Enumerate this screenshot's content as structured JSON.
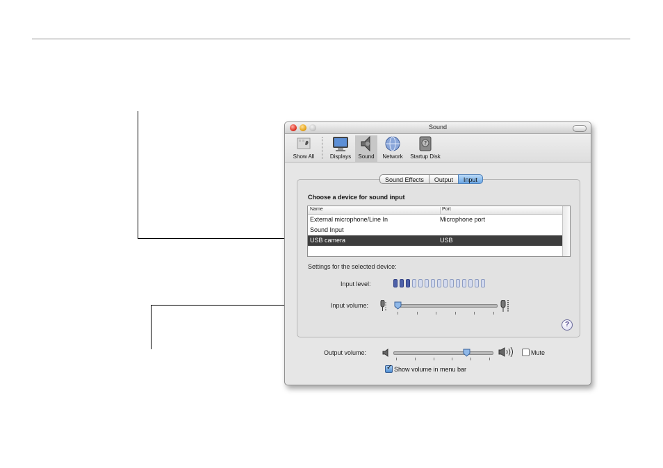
{
  "window": {
    "title": "Sound"
  },
  "toolbar": {
    "items": [
      {
        "label": "Show All",
        "icon": "show-all-icon"
      },
      {
        "label": "Displays",
        "icon": "display-icon"
      },
      {
        "label": "Sound",
        "icon": "speaker-icon",
        "selected": true
      },
      {
        "label": "Network",
        "icon": "network-globe-icon"
      },
      {
        "label": "Startup Disk",
        "icon": "hard-disk-icon"
      }
    ]
  },
  "tabs": [
    {
      "label": "Sound Effects"
    },
    {
      "label": "Output"
    },
    {
      "label": "Input",
      "active": true
    }
  ],
  "input": {
    "heading": "Choose a device for sound input",
    "columns": {
      "name": "Name",
      "port": "Port"
    },
    "devices": [
      {
        "name": "External microphone/Line In",
        "port": "Microphone port"
      },
      {
        "name": "Sound Input",
        "port": ""
      },
      {
        "name": "USB camera",
        "port": "USB",
        "selected": true
      }
    ],
    "settings_label": "Settings for the selected device:",
    "level_label": "Input level:",
    "level_bars_total": 15,
    "level_bars_lit": 3,
    "volume_label": "Input volume:",
    "volume_fraction": 0.03
  },
  "output": {
    "volume_label": "Output volume:",
    "volume_fraction": 0.74,
    "mute_label": "Mute",
    "mute_checked": false,
    "menu_bar_label": "Show volume in menu bar",
    "menu_bar_checked": true
  },
  "help": {
    "glyph": "?"
  },
  "colors": {
    "selection": "#3d3d3d",
    "tab_active": "#6aa7e6",
    "level_on": "#4d60a8"
  }
}
